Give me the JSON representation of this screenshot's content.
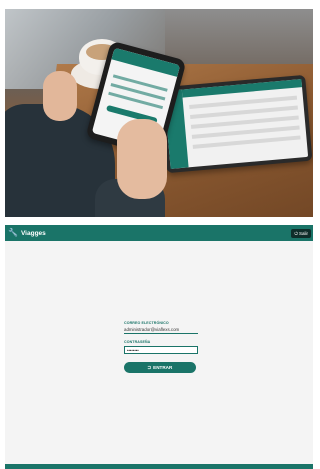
{
  "app": {
    "brand_icon": "wrench-icon",
    "brand_name": "Viagges",
    "exit_label": "Salir",
    "exit_icon": "power-icon"
  },
  "login": {
    "email_label": "CORREO ELECTRÓNICO",
    "email_value": "administrador@viaflexs.com",
    "password_label": "CONTRASEÑA",
    "password_value": "••••••••",
    "submit_label": "ENTRAR",
    "submit_icon": "login-icon"
  },
  "colors": {
    "primary": "#1a7468",
    "exit_bg": "#0f2d2a"
  }
}
